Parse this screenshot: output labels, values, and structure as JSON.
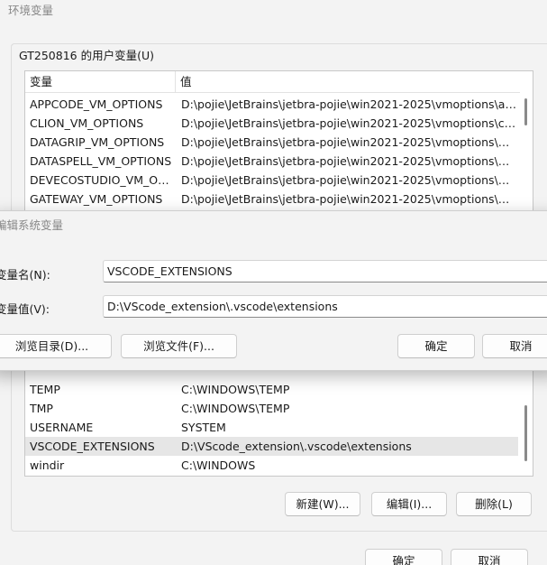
{
  "window": {
    "title": "环境变量",
    "user_group_label": "GT250816 的用户变量(U)"
  },
  "list": {
    "col_variable": "变量",
    "col_value": "值",
    "top_rows": [
      {
        "name": "APPCODE_VM_OPTIONS",
        "value": "D:\\pojie\\JetBrains\\jetbra-pojie\\win2021-2025\\vmoptions\\app..."
      },
      {
        "name": "CLION_VM_OPTIONS",
        "value": "D:\\pojie\\JetBrains\\jetbra-pojie\\win2021-2025\\vmoptions\\clio..."
      },
      {
        "name": "DATAGRIP_VM_OPTIONS",
        "value": "D:\\pojie\\JetBrains\\jetbra-pojie\\win2021-2025\\vmoptions\\dat..."
      },
      {
        "name": "DATASPELL_VM_OPTIONS",
        "value": "D:\\pojie\\JetBrains\\jetbra-pojie\\win2021-2025\\vmoptions\\dat..."
      },
      {
        "name": "DEVECOSTUDIO_VM_OPT...",
        "value": "D:\\pojie\\JetBrains\\jetbra-pojie\\win2021-2025\\vmoptions\\dev..."
      },
      {
        "name": "GATEWAY_VM_OPTIONS",
        "value": "D:\\pojie\\JetBrains\\jetbra-pojie\\win2021-2025\\vmoptions\\gat..."
      }
    ],
    "bottom_rows": [
      {
        "name": "TEMP",
        "value": "C:\\WINDOWS\\TEMP"
      },
      {
        "name": "TMP",
        "value": "C:\\WINDOWS\\TEMP"
      },
      {
        "name": "USERNAME",
        "value": "SYSTEM"
      },
      {
        "name": "VSCODE_EXTENSIONS",
        "value": "D:\\VScode_extension\\.vscode\\extensions"
      },
      {
        "name": "windir",
        "value": "C:\\WINDOWS"
      }
    ]
  },
  "list_buttons": {
    "new": "新建(W)...",
    "edit": "编辑(I)...",
    "delete": "删除(L)"
  },
  "footer_buttons": {
    "ok": "确定",
    "cancel": "取消"
  },
  "dialog": {
    "title": "编辑系统变量",
    "name_label": "变量名(N):",
    "name_value": "VSCODE_EXTENSIONS",
    "value_label": "变量值(V):",
    "value_value": "D:\\VScode_extension\\.vscode\\extensions",
    "browse_dir": "浏览目录(D)...",
    "browse_file": "浏览文件(F)...",
    "ok": "确定",
    "cancel": "取消"
  }
}
